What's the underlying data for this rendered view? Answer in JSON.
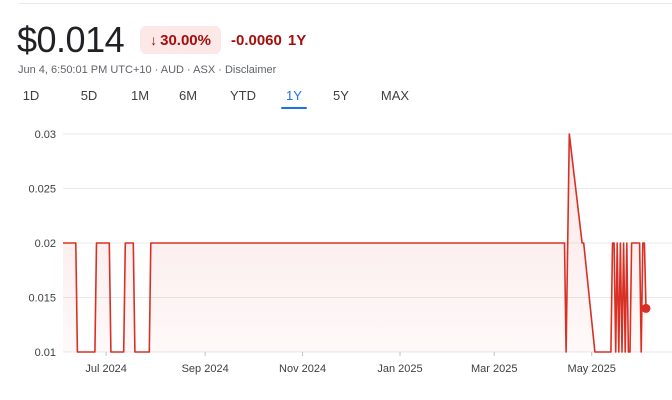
{
  "quote": {
    "price": "$0.014",
    "change_arrow": "↓",
    "change_percent": "30.00%",
    "change_value": "-0.0060",
    "change_period": "1Y",
    "meta": "Jun 4, 6:50:01 PM UTC+10 · AUD · ASX · Disclaimer",
    "colors": {
      "down": "#a50e0e",
      "down_bg": "#fce8e6",
      "line": "#d93025",
      "active_tab": "#1a73e8"
    }
  },
  "tabs": [
    {
      "label": "1D"
    },
    {
      "label": "5D"
    },
    {
      "label": "1M"
    },
    {
      "label": "6M"
    },
    {
      "label": "YTD"
    },
    {
      "label": "1Y",
      "active": true
    },
    {
      "label": "5Y"
    },
    {
      "label": "MAX"
    }
  ],
  "chart_data": {
    "type": "line",
    "ylim": [
      0.01,
      0.03
    ],
    "yticks": [
      "0.03",
      "0.025",
      "0.02",
      "0.015",
      "0.01"
    ],
    "xticks": [
      "Jul 2024",
      "Sep 2024",
      "Nov 2024",
      "Jan 2025",
      "Mar 2025",
      "May 2025"
    ],
    "grid": true,
    "x": [
      "2024-06-04",
      "2024-06-12",
      "2024-06-13",
      "2024-06-24",
      "2024-06-25",
      "2024-07-03",
      "2024-07-04",
      "2024-07-12",
      "2024-07-13",
      "2024-07-18",
      "2024-07-19",
      "2024-07-28",
      "2024-07-29",
      "2025-04-14",
      "2025-04-15",
      "2025-04-16",
      "2025-04-17",
      "2025-04-25",
      "2025-04-26",
      "2025-05-03",
      "2025-05-04",
      "2025-05-13",
      "2025-05-14",
      "2025-05-15",
      "2025-05-16",
      "2025-05-17",
      "2025-05-18",
      "2025-05-19",
      "2025-05-20",
      "2025-05-21",
      "2025-05-22",
      "2025-05-23",
      "2025-05-24",
      "2025-05-25",
      "2025-05-26",
      "2025-05-31",
      "2025-06-01",
      "2025-06-02",
      "2025-06-03",
      "2025-06-04"
    ],
    "values": [
      0.02,
      0.02,
      0.01,
      0.01,
      0.02,
      0.02,
      0.01,
      0.01,
      0.02,
      0.02,
      0.01,
      0.01,
      0.02,
      0.02,
      0.01,
      0.02,
      0.03,
      0.02,
      0.02,
      0.01,
      0.01,
      0.01,
      0.02,
      0.02,
      0.01,
      0.02,
      0.01,
      0.02,
      0.01,
      0.02,
      0.01,
      0.02,
      0.01,
      0.01,
      0.02,
      0.02,
      0.01,
      0.02,
      0.02,
      0.014
    ]
  }
}
